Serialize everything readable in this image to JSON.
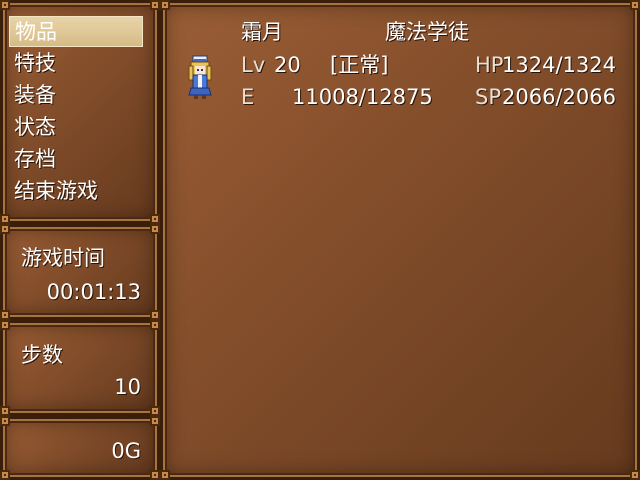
{
  "menu": {
    "items": [
      {
        "label": "物品",
        "selected": true
      },
      {
        "label": "特技",
        "selected": false
      },
      {
        "label": "装备",
        "selected": false
      },
      {
        "label": "状态",
        "selected": false
      },
      {
        "label": "存档",
        "selected": false
      },
      {
        "label": "结束游戏",
        "selected": false
      }
    ]
  },
  "playtime": {
    "label": "游戏时间",
    "value": "00:01:13"
  },
  "steps": {
    "label": "步数",
    "value": "10"
  },
  "gold": {
    "value": "0G"
  },
  "party": {
    "members": [
      {
        "name": "霜月",
        "class": "魔法学徒",
        "level_label": "Lv",
        "level": "20",
        "status": "[正常]",
        "exp_label": "E",
        "exp": "11008/12875",
        "hp_label": "HP",
        "hp": "1324/1324",
        "sp_label": "SP",
        "sp": "2066/2066",
        "sprite_icon": "mage-girl-sprite-icon"
      }
    ]
  },
  "colors": {
    "window": "#87502c",
    "border": "#3a1e0c",
    "trim": "#c48b45",
    "selection": "#e3cc9c"
  }
}
